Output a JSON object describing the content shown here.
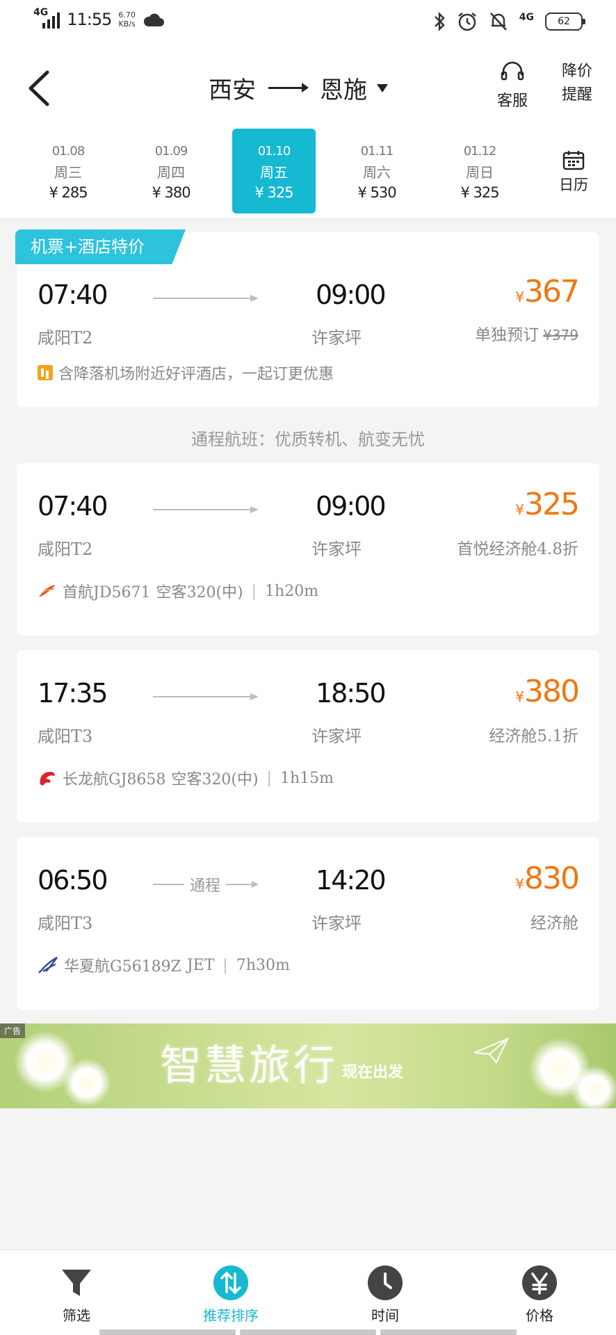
{
  "status_bar": {
    "network": "4G",
    "time": "11:55",
    "speed_value": "6.70",
    "speed_unit": "KB/s",
    "network_right": "4G",
    "battery": "62"
  },
  "header": {
    "from_city": "西安",
    "to_city": "恩施",
    "service_label": "客服",
    "price_alert_label_1": "降价",
    "price_alert_label_2": "提醒"
  },
  "date_tabs": [
    {
      "date": "01.08",
      "weekday": "周三",
      "price": "¥ 285"
    },
    {
      "date": "01.09",
      "weekday": "周四",
      "price": "¥ 380"
    },
    {
      "date": "01.10",
      "weekday": "周五",
      "price": "¥ 325"
    },
    {
      "date": "01.11",
      "weekday": "周六",
      "price": "¥ 530"
    },
    {
      "date": "01.12",
      "weekday": "周日",
      "price": "¥ 325"
    }
  ],
  "calendar_label": "日历",
  "promo_card": {
    "tag": "机票+酒店特价",
    "dep_time": "07:40",
    "arr_time": "09:00",
    "dep_airport": "咸阳T2",
    "arr_airport": "许家坪",
    "currency": "¥",
    "price": "367",
    "cabin_text": "单独预订",
    "original_price": "¥379",
    "hotel_note": "含降落机场附近好评酒店，一起订更优惠"
  },
  "transfer_banner": "通程航班：优质转机、航变无忧",
  "flights": [
    {
      "dep_time": "07:40",
      "arr_time": "09:00",
      "dep_airport": "咸阳T2",
      "arr_airport": "许家坪",
      "currency": "¥",
      "price": "325",
      "cabin": "首悦经济舱4.8折",
      "airline_flight": "首航JD5671",
      "aircraft": "空客320(中)",
      "duration": "1h20m",
      "line_label": ""
    },
    {
      "dep_time": "17:35",
      "arr_time": "18:50",
      "dep_airport": "咸阳T3",
      "arr_airport": "许家坪",
      "currency": "¥",
      "price": "380",
      "cabin": "经济舱5.1折",
      "airline_flight": "长龙航GJ8658",
      "aircraft": "空客320(中)",
      "duration": "1h15m",
      "line_label": ""
    },
    {
      "dep_time": "06:50",
      "arr_time": "14:20",
      "dep_airport": "咸阳T3",
      "arr_airport": "许家坪",
      "currency": "¥",
      "price": "830",
      "cabin": "经济舱",
      "airline_flight": "华夏航G56189Z",
      "aircraft": "JET",
      "duration": "7h30m",
      "line_label": "通程"
    }
  ],
  "ad": {
    "tag": "广告",
    "title": "智慧旅行",
    "subtitle": "现在出发"
  },
  "bottom_nav": [
    {
      "label": "筛选",
      "icon": "filter-icon"
    },
    {
      "label": "推荐排序",
      "icon": "sort-icon"
    },
    {
      "label": "时间",
      "icon": "clock-icon"
    },
    {
      "label": "价格",
      "icon": "yen-icon"
    }
  ],
  "colors": {
    "accent": "#16b8d2",
    "price": "#f0770f"
  }
}
